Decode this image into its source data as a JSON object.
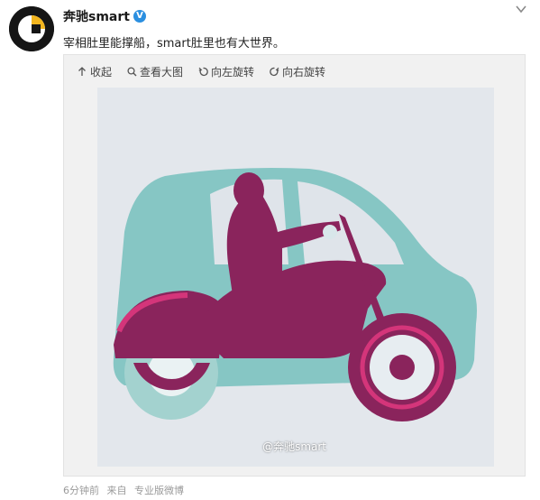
{
  "post": {
    "author": "奔驰smart",
    "verified_badge": "V",
    "text": "宰相肚里能撑船，smart肚里也有大世界。",
    "time": "6分钟前",
    "source_prefix": "来自",
    "source": "专业版微博"
  },
  "toolbar": {
    "collapse": "收起",
    "view_large": "查看大图",
    "rotate_left": "向左旋转",
    "rotate_right": "向右旋转"
  },
  "image": {
    "watermark": "@奔驰smart"
  },
  "icons": [
    "chevron-down-icon",
    "up-arrow-icon",
    "magnifier-icon",
    "rotate-left-icon",
    "rotate-right-icon"
  ],
  "colors": {
    "car_teal": "#86c6c4",
    "rider_purple": "#8a245c",
    "wheel_pink": "#d4357a",
    "background": "#e3e7ec",
    "verified_blue": "#2b8fe0"
  }
}
